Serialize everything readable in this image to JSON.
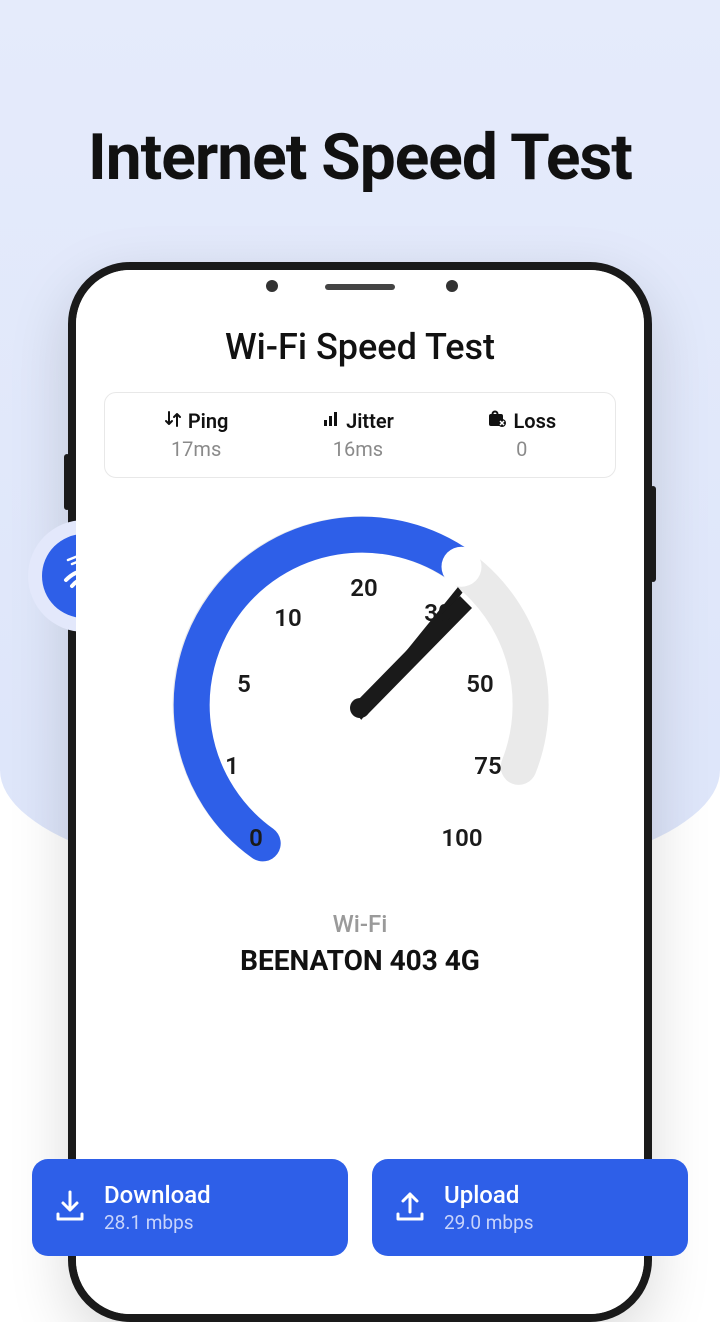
{
  "headline": "Internet Speed Test",
  "app": {
    "title": "Wi-Fi Speed Test"
  },
  "stats": {
    "ping": {
      "label": "Ping",
      "value": "17ms"
    },
    "jitter": {
      "label": "Jitter",
      "value": "16ms"
    },
    "loss": {
      "label": "Loss",
      "value": "0"
    }
  },
  "gauge": {
    "ticks": [
      "0",
      "1",
      "5",
      "10",
      "20",
      "30",
      "50",
      "75",
      "100"
    ],
    "needle_value": 30
  },
  "connection": {
    "type": "Wi-Fi",
    "name": "BEENATON 403 4G"
  },
  "results": {
    "download": {
      "label": "Download",
      "value": "28.1 mbps"
    },
    "upload": {
      "label": "Upload",
      "value": "29.0 mbps"
    }
  },
  "colors": {
    "accent": "#2e5fe8"
  }
}
